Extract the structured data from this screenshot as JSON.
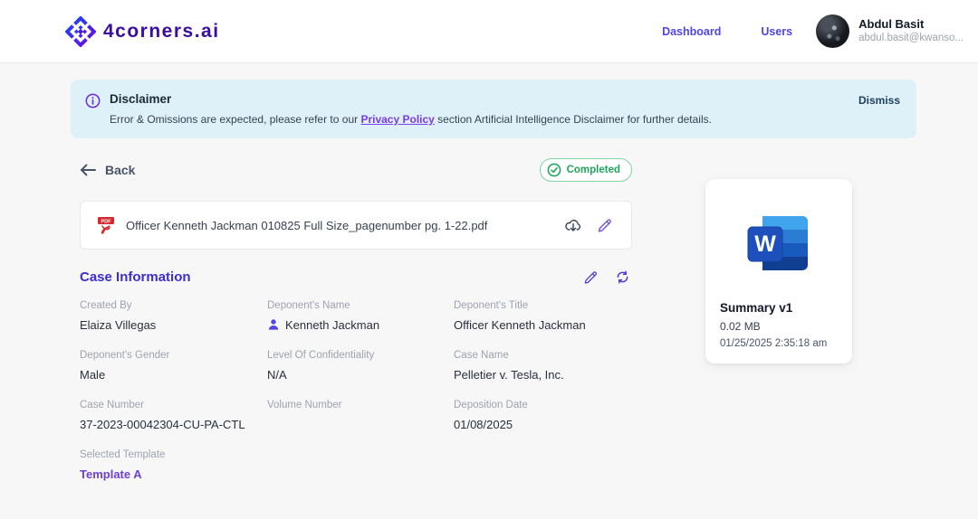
{
  "header": {
    "logo_text": "4corners.ai",
    "nav": [
      {
        "label": "Dashboard"
      },
      {
        "label": "Users"
      }
    ],
    "user": {
      "name": "Abdul Basit",
      "email": "abdul.basit@kwanso..."
    }
  },
  "banner": {
    "title": "Disclaimer",
    "message_prefix": "Error & Omissions are expected, please refer to our ",
    "link_text": "Privacy Policy",
    "message_suffix": " section Artificial Intelligence Disclaimer for further details.",
    "dismiss_label": "Dismiss"
  },
  "toolbar": {
    "back_label": "Back",
    "status_label": "Completed"
  },
  "file_card": {
    "filename": "Officer Kenneth Jackman 010825 Full Size_pagenumber pg. 1-22.pdf",
    "icons": [
      "download-icon",
      "edit-icon"
    ]
  },
  "case_information": {
    "title": "Case Information",
    "fields": [
      {
        "label": "Created By",
        "value": "Elaiza Villegas"
      },
      {
        "label": "Deponent's Name",
        "value": "Kenneth Jackman",
        "icon": "person-icon"
      },
      {
        "label": "Deponent's Title",
        "value": "Officer Kenneth Jackman"
      },
      {
        "label": "Deponent's Gender",
        "value": "Male"
      },
      {
        "label": "Level Of Confidentiality",
        "value": "N/A"
      },
      {
        "label": "Case Name",
        "value": "Pelletier v. Tesla, Inc."
      },
      {
        "label": "Case Number",
        "value": "37-2023-00042304-CU-PA-CTL"
      },
      {
        "label": "Volume Number",
        "value": ""
      },
      {
        "label": "Deposition Date",
        "value": "01/08/2025"
      },
      {
        "label": "Selected Template",
        "value": "Template A",
        "is_link": true
      }
    ]
  },
  "summary_card": {
    "title": "Summary v1",
    "size": "0.02 MB",
    "timestamp": "01/25/2025 2:35:18 am"
  },
  "colors": {
    "accent_indigo": "#4f46e5",
    "logo_purple": "#3a0ca3",
    "case_title": "#3b2ed0",
    "link_purple": "#7c3aed",
    "banner_bg": "#def1f9",
    "status_green": "#22a35f",
    "word_blue_1": "#41a5ee",
    "word_blue_2": "#2b7cd3",
    "word_blue_3": "#185abd",
    "word_blue_4": "#103f91"
  }
}
